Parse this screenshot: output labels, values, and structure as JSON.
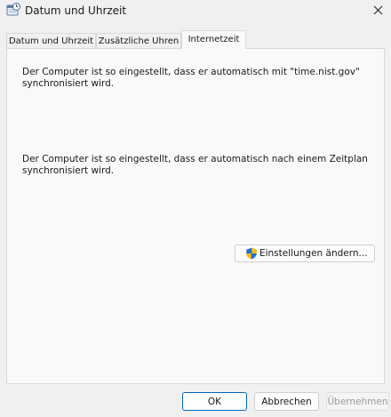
{
  "window": {
    "title": "Datum und Uhrzeit",
    "icon": "clock-calendar-icon",
    "close_icon": "close-icon"
  },
  "tabs": [
    {
      "label": "Datum und Uhrzeit",
      "active": false
    },
    {
      "label": "Zusätzliche Uhren",
      "active": false
    },
    {
      "label": "Internetzeit",
      "active": true
    }
  ],
  "panel": {
    "sync_line1": "Der Computer ist so eingestellt, dass er automatisch mit \"time.nist.gov\"",
    "sync_line2": "synchronisiert wird.",
    "schedule_line1": "Der Computer ist so eingestellt, dass er automatisch nach einem Zeitplan",
    "schedule_line2": "synchronisiert wird.",
    "settings_button": "Einstellungen ändern...",
    "settings_icon": "uac-shield-icon"
  },
  "footer": {
    "ok": "OK",
    "cancel": "Abbrechen",
    "apply": "Übernehmen",
    "apply_enabled": false
  },
  "colors": {
    "window_bg": "#f0f0f0",
    "panel_bg": "#f9f9f9",
    "accent": "#0067c0",
    "disabled_text": "#9a9a9a"
  }
}
